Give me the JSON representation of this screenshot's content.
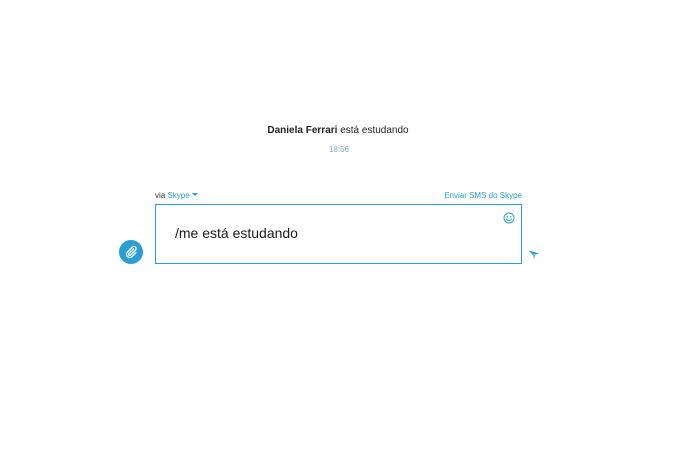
{
  "conversation": {
    "status_name": "Daniela Ferrari",
    "status_text": " está estudando",
    "timestamp": "18:56"
  },
  "composer": {
    "via_prefix": "via ",
    "via_service": "Skype",
    "sms_link": "Enviar SMS do Skype",
    "input_value": "/me está estudando"
  },
  "icons": {
    "attach": "paperclip-icon",
    "emoji": "smiley-icon",
    "send": "send-arrow-icon",
    "dropdown": "caret-down-icon"
  },
  "colors": {
    "accent": "#2a9fd6",
    "timestamp": "#7fb3cf",
    "text": "#222222"
  }
}
